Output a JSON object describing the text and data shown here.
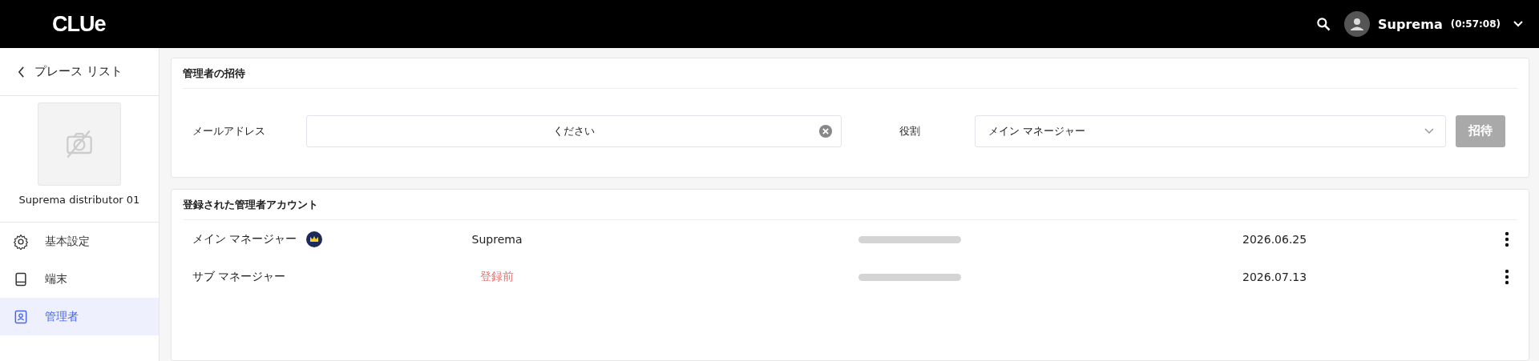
{
  "header": {
    "logo": "CLUe",
    "user": {
      "name": "Suprema",
      "session_time": "(0:57:08)"
    }
  },
  "sidebar": {
    "back_label": "プレース リスト",
    "place_name": "Suprema distributor 01",
    "items": [
      {
        "label": "基本設定",
        "selected": false
      },
      {
        "label": "端末",
        "selected": false
      },
      {
        "label": "管理者",
        "selected": true
      }
    ]
  },
  "invite": {
    "title": "管理者の招待",
    "email_label": "メールアドレス",
    "email_value": "ください",
    "role_label": "役割",
    "role_value": "メイン マネージャー",
    "button": {
      "label": "招待",
      "disabled": true
    }
  },
  "accounts": {
    "title": "登録された管理者アカウント",
    "rows": [
      {
        "role": "メイン マネージャー",
        "owner": true,
        "name": "Suprema",
        "pending": false,
        "date": "2026.06.25"
      },
      {
        "role": "サブ マネージャー",
        "owner": false,
        "name": "登録前",
        "pending": true,
        "date": "2026.07.13"
      }
    ]
  }
}
